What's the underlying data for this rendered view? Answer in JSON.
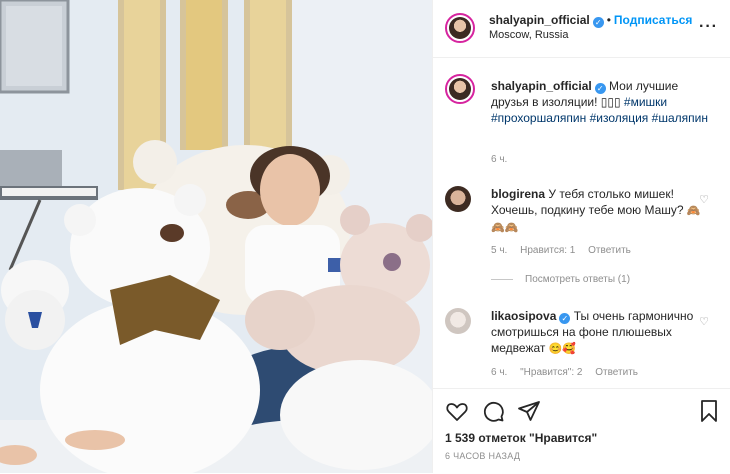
{
  "header": {
    "username": "shalyapin_official",
    "follow_label": "Подписаться",
    "location": "Moscow, Russia",
    "more_icon": "more-horizontal-icon"
  },
  "caption": {
    "username": "shalyapin_official",
    "text": "Мои лучшие друзья в изоляции! ",
    "emojis": "▯▯▯",
    "hashtags": [
      "#мишки",
      "#прохоршаляпин",
      "#изоляция",
      "#шаляпин"
    ],
    "time": "6 ч."
  },
  "comments": [
    {
      "username": "blogirena",
      "text": "У тебя столько мишек! Хочешь, подкину тебе мою Машу? ",
      "emojis": "🙈🙈🙈",
      "time": "5 ч.",
      "likes_label": "Нравится: 1",
      "reply_label": "Ответить",
      "view_replies": "Посмотреть ответы (1)"
    },
    {
      "username": "likaosipova",
      "text": "Ты очень гармонично смотришься на фоне плюшевых медвежат ",
      "emojis": "😊🥰",
      "time": "6 ч.",
      "likes_label": "\"Нравится\": 2",
      "reply_label": "Ответить"
    }
  ],
  "actions": {
    "icons": [
      "heart-icon",
      "comment-icon",
      "share-icon",
      "bookmark-icon"
    ],
    "likes_text": "1 539 отметок \"Нравится\"",
    "time_ago": "6 ЧАСОВ НАЗАД"
  },
  "colors": {
    "link_blue": "#0095f6",
    "hashtag": "#00376b",
    "muted": "#8e8e8e",
    "story_ring": "#d6249f"
  }
}
